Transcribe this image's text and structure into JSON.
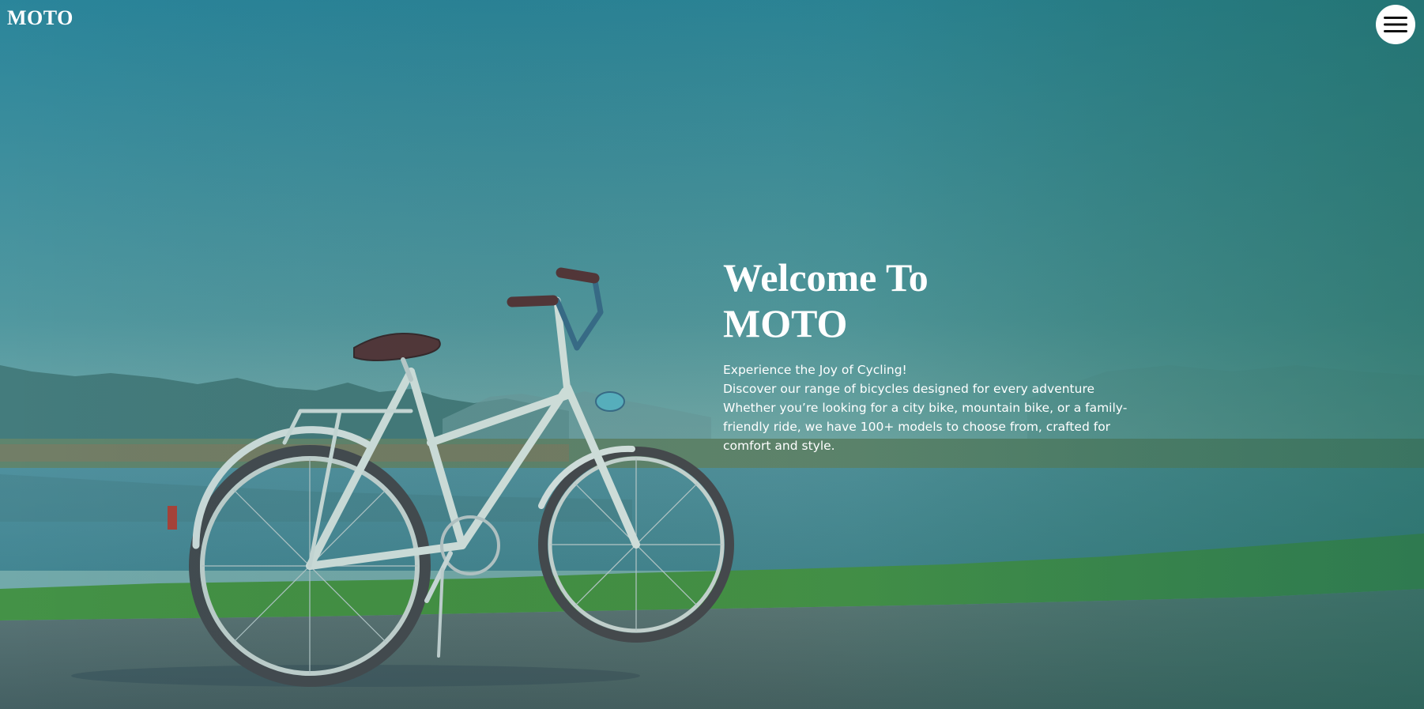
{
  "header": {
    "logo": "MOTO",
    "menu_icon": "hamburger-menu-icon"
  },
  "hero": {
    "title_line1": "Welcome To",
    "title_line2": "MOTO",
    "tagline": "Experience the Joy of Cycling!",
    "subtitle": "Discover our range of bicycles designed for every adventure",
    "body": "Whether you’re looking for a city bike, mountain bike, or a family-friendly ride, we have 100+ models to choose from, crafted for comfort and style."
  },
  "colors": {
    "text": "#ffffff",
    "menu_button_bg": "#ffffff",
    "menu_icon": "#111111",
    "sky": "#3d8a96",
    "grass": "#4e9a3a",
    "road": "#5c6a68"
  }
}
